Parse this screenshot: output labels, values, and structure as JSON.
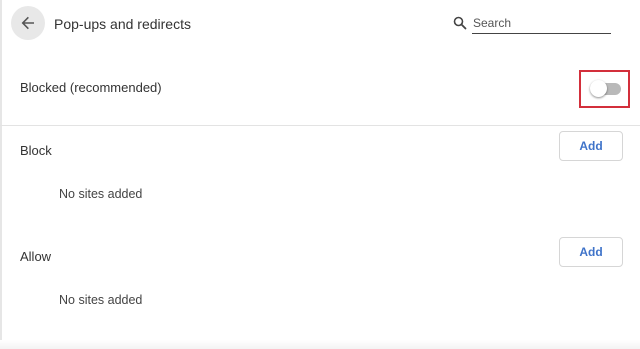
{
  "header": {
    "title": "Pop-ups and redirects",
    "back_icon": "arrow-back-icon",
    "search": {
      "placeholder": "Search",
      "value": "",
      "icon": "search-icon"
    }
  },
  "blocked_setting": {
    "label": "Blocked (recommended)",
    "toggle_on": false,
    "highlight_color": "#d32f3b"
  },
  "sections": {
    "block": {
      "title": "Block",
      "add_label": "Add",
      "empty_text": "No sites added"
    },
    "allow": {
      "title": "Allow",
      "add_label": "Add",
      "empty_text": "No sites added"
    }
  },
  "colors": {
    "accent": "#3f73c9",
    "toggle_track_off": "#b9b9b9"
  }
}
